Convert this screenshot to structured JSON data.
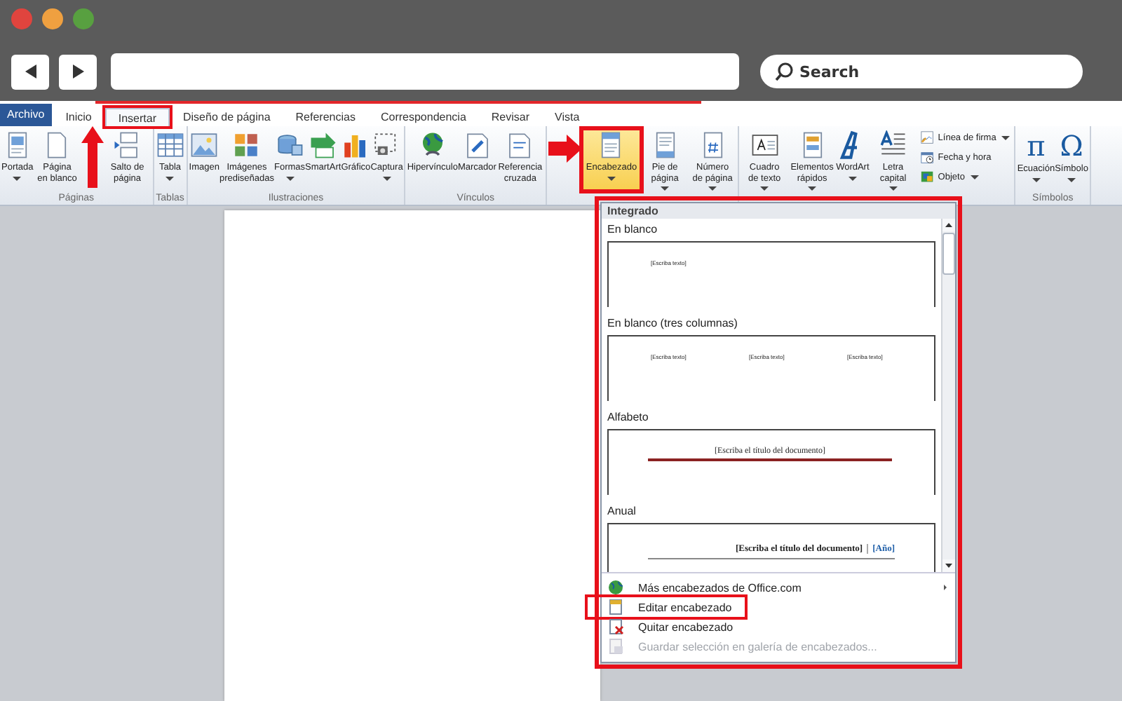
{
  "browser": {
    "search": {
      "placeholder": "Search"
    }
  },
  "tabs": [
    {
      "label": "Archivo",
      "kind": "file",
      "selected": false,
      "highlighted": false
    },
    {
      "label": "Inicio",
      "kind": "tab",
      "selected": false,
      "highlighted": false
    },
    {
      "label": "Insertar",
      "kind": "tab",
      "selected": true,
      "highlighted": true
    },
    {
      "label": "Diseño de página",
      "kind": "tab",
      "selected": false,
      "highlighted": false
    },
    {
      "label": "Referencias",
      "kind": "tab",
      "selected": false,
      "highlighted": false
    },
    {
      "label": "Correspondencia",
      "kind": "tab",
      "selected": false,
      "highlighted": false
    },
    {
      "label": "Revisar",
      "kind": "tab",
      "selected": false,
      "highlighted": false
    },
    {
      "label": "Vista",
      "kind": "tab",
      "selected": false,
      "highlighted": false
    }
  ],
  "ribbon": {
    "groups": [
      {
        "label": "Páginas",
        "buttons": [
          {
            "label": "Portada",
            "kind": "large",
            "menu": true,
            "highlighted": false
          },
          {
            "label": "Página en blanco",
            "kind": "large",
            "menu": false,
            "highlighted": false
          },
          {
            "label": "Salto de página",
            "kind": "large",
            "menu": false,
            "highlighted": false
          }
        ]
      },
      {
        "label": "Tablas",
        "buttons": [
          {
            "label": "Tabla",
            "kind": "large",
            "menu": true,
            "highlighted": false
          }
        ]
      },
      {
        "label": "Ilustraciones",
        "buttons": [
          {
            "label": "Imagen",
            "kind": "large",
            "menu": false,
            "highlighted": false
          },
          {
            "label": "Imágenes prediseñadas",
            "kind": "large",
            "menu": false,
            "highlighted": false
          },
          {
            "label": "Formas",
            "kind": "large",
            "menu": true,
            "highlighted": false
          },
          {
            "label": "SmartArt",
            "kind": "large",
            "menu": false,
            "highlighted": false
          },
          {
            "label": "Gráfico",
            "kind": "large",
            "menu": false,
            "highlighted": false
          },
          {
            "label": "Captura",
            "kind": "large",
            "menu": true,
            "highlighted": false
          }
        ]
      },
      {
        "label": "Vínculos",
        "buttons": [
          {
            "label": "Hipervínculo",
            "kind": "large",
            "menu": false,
            "highlighted": false
          },
          {
            "label": "Marcador",
            "kind": "large",
            "menu": false,
            "highlighted": false
          },
          {
            "label": "Referencia cruzada",
            "kind": "large",
            "menu": false,
            "highlighted": false
          }
        ]
      },
      {
        "buttons": [
          {
            "label": "Encabezado",
            "kind": "large",
            "menu": true,
            "highlighted": true
          },
          {
            "label": "Pie de página",
            "kind": "large",
            "menu": true,
            "highlighted": false
          },
          {
            "label": "Número de página",
            "kind": "large",
            "menu": true,
            "highlighted": false
          }
        ]
      },
      {
        "buttons": [
          {
            "label": "Cuadro de texto",
            "kind": "large",
            "menu": true,
            "highlighted": false
          },
          {
            "label": "Elementos rápidos",
            "kind": "large",
            "menu": true,
            "highlighted": false
          },
          {
            "label": "WordArt",
            "kind": "large",
            "menu": true,
            "highlighted": false
          },
          {
            "label": "Letra capital",
            "kind": "large",
            "menu": true,
            "highlighted": false
          },
          {
            "label": "Línea de firma",
            "kind": "small",
            "menu": true,
            "highlighted": false
          },
          {
            "label": "Fecha y hora",
            "kind": "small",
            "menu": false,
            "highlighted": false
          },
          {
            "label": "Objeto",
            "kind": "small",
            "menu": true,
            "highlighted": false
          }
        ]
      },
      {
        "label": "Símbolos",
        "buttons": [
          {
            "label": "Ecuación",
            "kind": "large",
            "menu": true,
            "highlighted": false,
            "glyph": "π"
          },
          {
            "label": "Símbolo",
            "kind": "large",
            "menu": true,
            "highlighted": false,
            "glyph": "Ω"
          }
        ]
      }
    ]
  },
  "gallery": {
    "heading": "Integrado",
    "highlighted": true,
    "items": [
      {
        "title": "En blanco",
        "kind": "blank",
        "texts": [
          "[Escriba texto]"
        ]
      },
      {
        "title": "En blanco (tres columnas)",
        "kind": "three",
        "texts": [
          "[Escriba texto]",
          "[Escriba texto]",
          "[Escriba texto]"
        ]
      },
      {
        "title": "Alfabeto",
        "kind": "alphabet",
        "texts": [
          "[Escriba el título del documento]"
        ]
      },
      {
        "title": "Anual",
        "kind": "annual",
        "texts": [
          "[Escriba el título del documento]",
          "[Año]"
        ]
      }
    ],
    "menu": [
      {
        "label": "Más encabezados de Office.com",
        "submenu": true,
        "disabled": false,
        "highlighted": false
      },
      {
        "label": "Editar encabezado",
        "submenu": false,
        "disabled": false,
        "highlighted": true
      },
      {
        "label": "Quitar encabezado",
        "submenu": false,
        "disabled": false,
        "highlighted": false
      },
      {
        "label": "Guardar selección en galería de encabezados...",
        "submenu": false,
        "disabled": true,
        "highlighted": false
      }
    ]
  }
}
